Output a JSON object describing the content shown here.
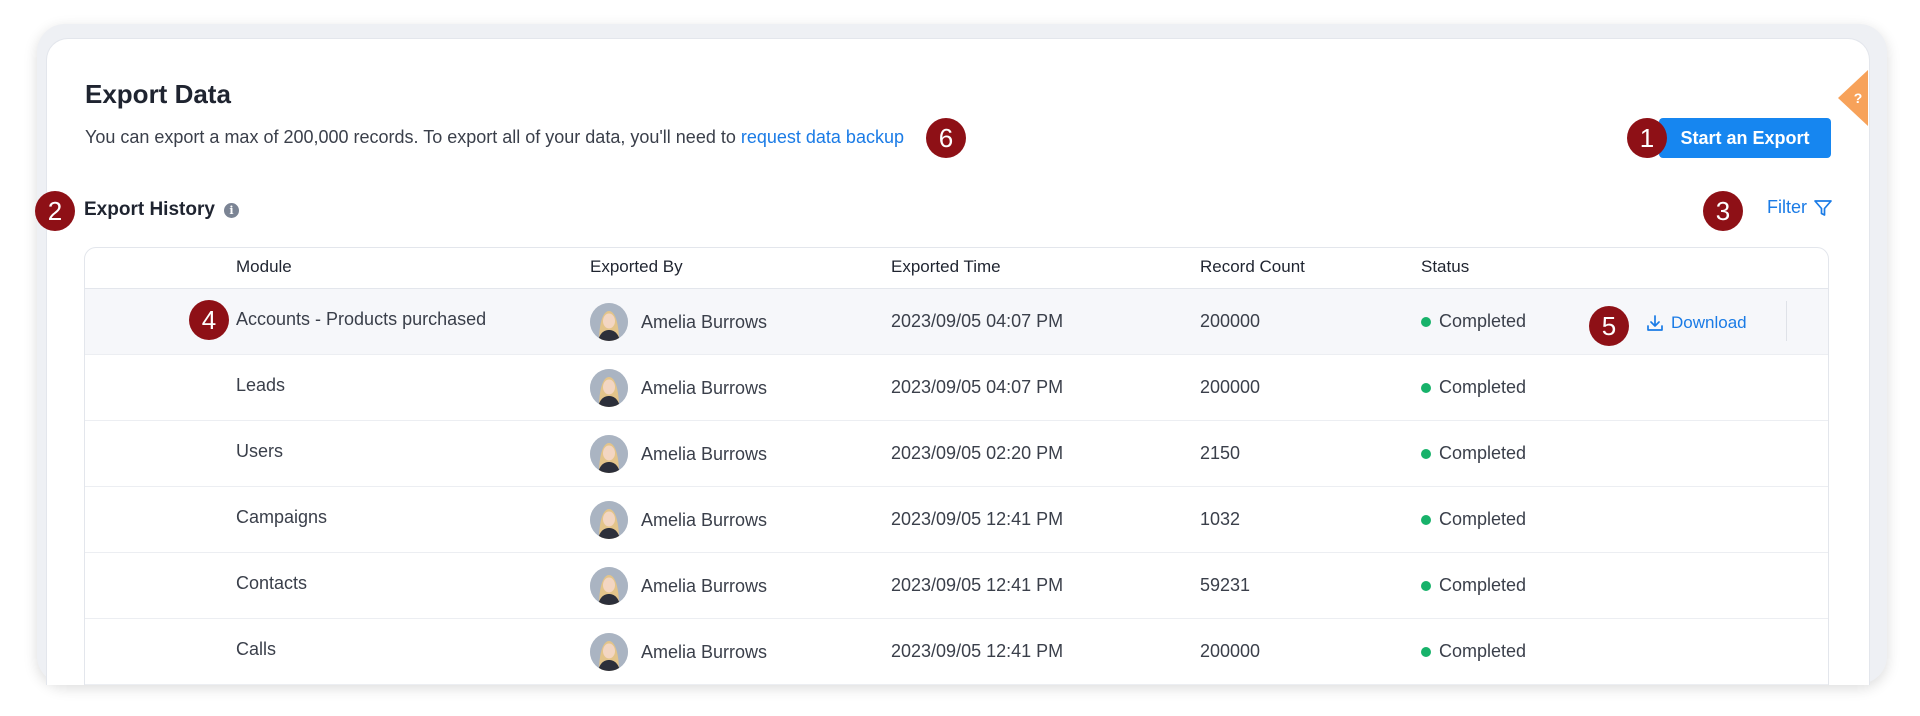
{
  "page": {
    "title": "Export Data",
    "description_text": "You can export a max of 200,000 records. To export all of your data, you'll need to ",
    "description_link": "request data backup",
    "start_button": "Start an Export",
    "help_tab_label": "?"
  },
  "history": {
    "title": "Export History",
    "info_glyph": "i",
    "filter_label": "Filter"
  },
  "table": {
    "headers": [
      "Module",
      "Exported By",
      "Exported Time",
      "Record Count",
      "Status"
    ],
    "rows": [
      {
        "module": "Accounts - Products purchased",
        "user": "Amelia Burrows",
        "time": "2023/09/05 04:07 PM",
        "count": "200000",
        "status": "Completed",
        "action": "Download"
      },
      {
        "module": "Leads",
        "user": "Amelia Burrows",
        "time": "2023/09/05 04:07 PM",
        "count": "200000",
        "status": "Completed"
      },
      {
        "module": "Users",
        "user": "Amelia Burrows",
        "time": "2023/09/05 02:20 PM",
        "count": "2150",
        "status": "Completed"
      },
      {
        "module": "Campaigns",
        "user": "Amelia Burrows",
        "time": "2023/09/05 12:41 PM",
        "count": "1032",
        "status": "Completed"
      },
      {
        "module": "Contacts",
        "user": "Amelia Burrows",
        "time": "2023/09/05 12:41 PM",
        "count": "59231",
        "status": "Completed"
      },
      {
        "module": "Calls",
        "user": "Amelia Burrows",
        "time": "2023/09/05 12:41 PM",
        "count": "200000",
        "status": "Completed"
      }
    ]
  },
  "badges": [
    "1",
    "2",
    "3",
    "4",
    "5",
    "6"
  ],
  "colors": {
    "accent": "#1686f0",
    "link": "#1a7be6",
    "status_completed": "#17b26a",
    "badge": "#8e1016",
    "help_tab": "#f7a25a"
  },
  "icons": {
    "info": "info-icon",
    "filter": "filter-funnel-icon",
    "download": "download-icon",
    "avatar": "user-avatar",
    "help": "help-question-icon"
  }
}
